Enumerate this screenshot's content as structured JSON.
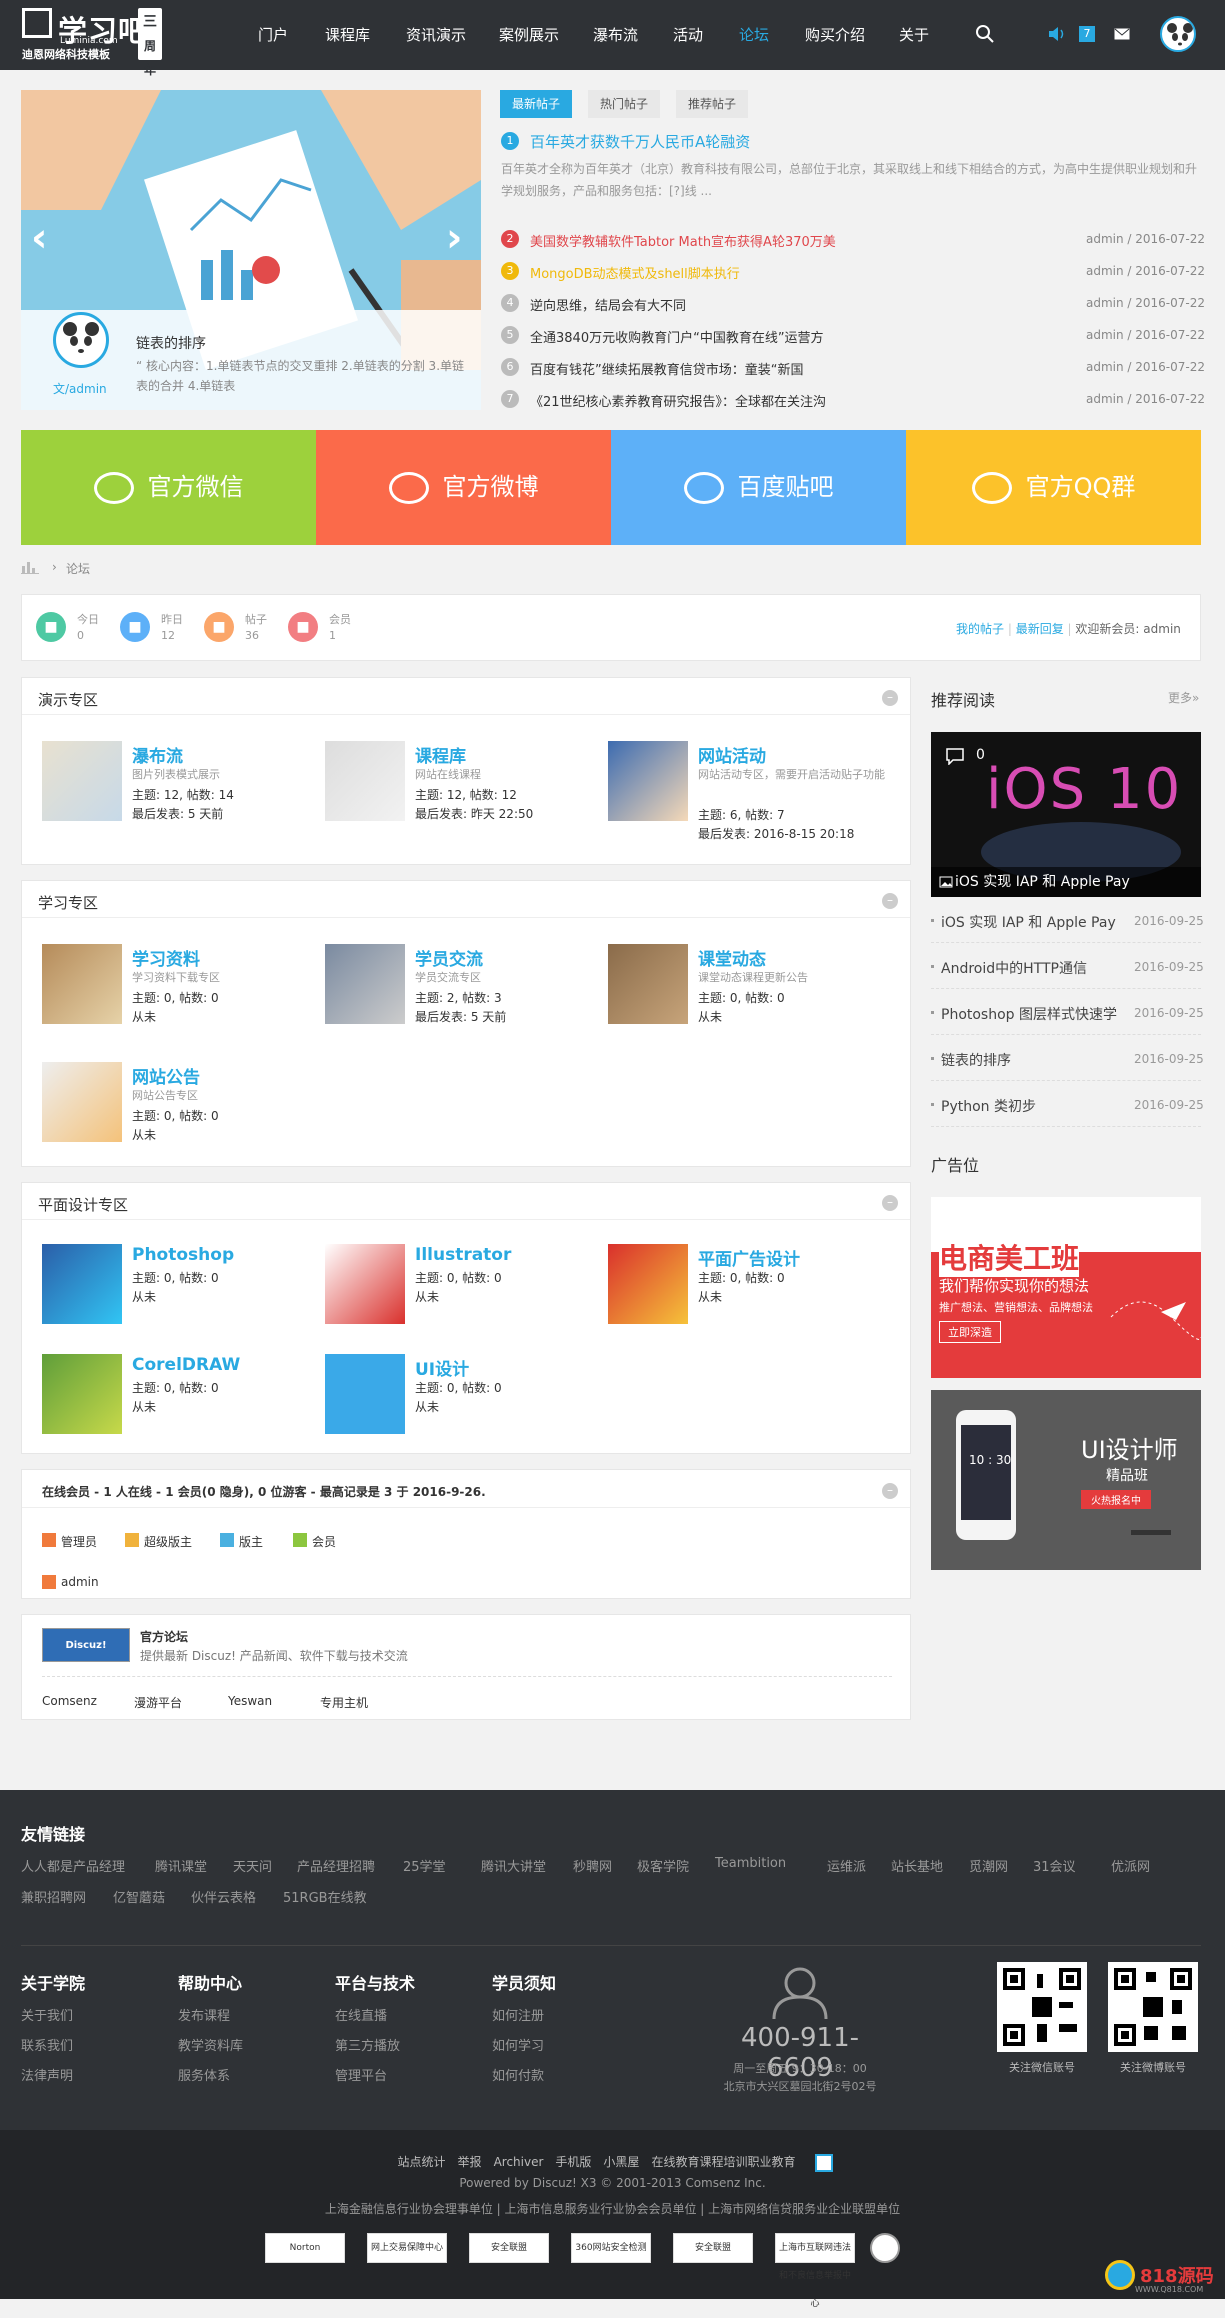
{
  "header": {
    "logo_text": "学习吧",
    "logo_domain": "Luminia.com",
    "logo_sub": "迪恩网络科技模板",
    "badge": "周年",
    "badge_num": "三",
    "nav": [
      "门户",
      "课程库",
      "资讯演示",
      "案例展示",
      "瀑布流",
      "活动",
      "论坛",
      "购买介绍",
      "关于"
    ],
    "active": "论坛",
    "notif_count": "7"
  },
  "slider": {
    "title": "链表的排序",
    "desc": "“ 核心内容：1.单链表节点的交叉重排 2.单链表的分割 3.单链表的合并 4.单链表",
    "author": "文/admin"
  },
  "tabs": [
    "最新帖子",
    "热门帖子",
    "推荐帖子"
  ],
  "featured": {
    "num": "1",
    "title": "百年英才获数千万人民币A轮融资",
    "desc": "百年英才全称为百年英才（北京）教育科技有限公司，总部位于北京，其采取线上和线下相结合的方式，为高中生提供职业规划和升学规划服务，产品和服务包括：[?]线 ..."
  },
  "posts": [
    {
      "num": "2",
      "title": "美国数学教辅软件Tabtor Math宣布获得A轮370万美",
      "meta": "admin / 2016-07-22",
      "color": "#e0474c"
    },
    {
      "num": "3",
      "title": "MongoDB动态模式及shell脚本执行",
      "meta": "admin / 2016-07-22",
      "color": "#f0b90b"
    },
    {
      "num": "4",
      "title": "逆向思维，结局会有大不同",
      "meta": "admin / 2016-07-22",
      "color": "#bbbbbb"
    },
    {
      "num": "5",
      "title": "全通3840万元收购教育门户“中国教育在线”运营方",
      "meta": "admin / 2016-07-22",
      "color": "#bbbbbb"
    },
    {
      "num": "6",
      "title": "百度有钱花”继续拓展教育信贷市场：童装“新国",
      "meta": "admin / 2016-07-22",
      "color": "#bbbbbb"
    },
    {
      "num": "7",
      "title": "《21世纪核心素养教育研究报告》：全球都在关注沟",
      "meta": "admin / 2016-07-22",
      "color": "#bbbbbb"
    }
  ],
  "social": [
    {
      "label": "官方微信",
      "color": "#9dd13c"
    },
    {
      "label": "官方微博",
      "color": "#fb6a4a"
    },
    {
      "label": "百度贴吧",
      "color": "#5db0f8"
    },
    {
      "label": "官方QQ群",
      "color": "#fcc22a"
    }
  ],
  "breadcrumb": "论坛",
  "stats": [
    {
      "label": "今日",
      "value": "0",
      "color": "#4ec9a3"
    },
    {
      "label": "昨日",
      "value": "12",
      "color": "#5db0f8"
    },
    {
      "label": "帖子",
      "value": "36",
      "color": "#fba66a"
    },
    {
      "label": "会员",
      "value": "1",
      "color": "#f27e82"
    }
  ],
  "stats_links": {
    "my": "我的帖子",
    "latest": "最新回复",
    "welcome": "欢迎新会员:",
    "user": "admin"
  },
  "sections": [
    {
      "title": "演示专区",
      "forums": [
        {
          "name": "瀑布流",
          "desc": "图片列表模式展示",
          "l1": "主题: 12, 帖数: 14",
          "l2": "最后发表: 5 天前"
        },
        {
          "name": "课程库",
          "desc": "网站在线课程",
          "l1": "主题: 12, 帖数: 12",
          "l2": "最后发表: 昨天 22:50"
        },
        {
          "name": "网站活动",
          "desc": "网站活动专区，需要开启活动贴子功能",
          "l1": "主题: 6, 帖数: 7",
          "l2": "最后发表: 2016-8-15 20:18"
        }
      ]
    },
    {
      "title": "学习专区",
      "forums": [
        {
          "name": "学习资料",
          "desc": "学习资料下载专区",
          "l1": "主题: 0, 帖数: 0",
          "l2": "从未"
        },
        {
          "name": "学员交流",
          "desc": "学员交流专区",
          "l1": "主题: 2, 帖数: 3",
          "l2": "最后发表: 5 天前"
        },
        {
          "name": "课堂动态",
          "desc": "课堂动态课程更新公告",
          "l1": "主题: 0, 帖数: 0",
          "l2": "从未"
        },
        {
          "name": "网站公告",
          "desc": "网站公告专区",
          "l1": "主题: 0, 帖数: 0",
          "l2": "从未"
        }
      ]
    },
    {
      "title": "平面设计专区",
      "forums": [
        {
          "name": "Photoshop",
          "desc": "",
          "l1": "主题: 0, 帖数: 0",
          "l2": "从未"
        },
        {
          "name": "Illustrator",
          "desc": "",
          "l1": "主题: 0, 帖数: 0",
          "l2": "从未"
        },
        {
          "name": "平面广告设计",
          "desc": "",
          "l1": "主题: 0, 帖数: 0",
          "l2": "从未"
        },
        {
          "name": "CorelDRAW",
          "desc": "",
          "l1": "主题: 0, 帖数: 0",
          "l2": "从未"
        },
        {
          "name": "UI设计",
          "desc": "",
          "l1": "主题: 0, 帖数: 0",
          "l2": "从未"
        }
      ]
    }
  ],
  "online": {
    "title": "在线会员 - 1 人在线 - 1 会员(0 隐身), 0 位游客 - 最高记录是 3 于 2016-9-26.",
    "roles": [
      "管理员",
      "超级版主",
      "版主",
      "会员"
    ],
    "user": "admin"
  },
  "friend_forum": {
    "name": "官方论坛",
    "desc": "提供最新 Discuz! 产品新闻、软件下载与技术交流",
    "logo": "Discuz!",
    "links": [
      "Comsenz",
      "漫游平台",
      "Yeswan",
      "专用主机"
    ]
  },
  "sidebar": {
    "read_title": "推荐阅读",
    "more": "更多»",
    "img_caption": "iOS 实现 IAP 和 Apple Pay",
    "img_count": "0",
    "img_text": "iOS 10",
    "items": [
      {
        "title": "iOS 实现 IAP 和 Apple Pay",
        "date": "2016-09-25"
      },
      {
        "title": "Android中的HTTP通信",
        "date": "2016-09-25"
      },
      {
        "title": "Photoshop 图层样式快速学",
        "date": "2016-09-25"
      },
      {
        "title": "链表的排序",
        "date": "2016-09-25"
      },
      {
        "title": "Python 类初步",
        "date": "2016-09-25"
      }
    ],
    "ad_title": "广告位",
    "ad1": {
      "title": "电商美工班",
      "sub": "我们帮你实现你的想法",
      "sub2": "推广想法、营销想法、品牌想法",
      "btn": "立即深造"
    },
    "ad2": {
      "title": "UI设计师",
      "sub": "精品班",
      "btn": "火热报名中",
      "screen": "10 : 30"
    }
  },
  "footer": {
    "links_title": "友情链接",
    "links": [
      "人人都是产品经理",
      "腾讯课堂",
      "天天问",
      "产品经理招聘",
      "25学堂",
      "腾讯大讲堂",
      "秒聘网",
      "极客学院",
      "Teambition",
      "运维派",
      "站长基地",
      "觅潮网",
      "31会议",
      "优派网",
      "兼职招聘网",
      "亿智蘑菇",
      "伙伴云表格",
      "51RGB在线教"
    ],
    "cols": [
      {
        "title": "关于学院",
        "items": [
          "关于我们",
          "联系我们",
          "法律声明"
        ]
      },
      {
        "title": "帮助中心",
        "items": [
          "发布课程",
          "教学资料库",
          "服务体系"
        ]
      },
      {
        "title": "平台与技术",
        "items": [
          "在线直播",
          "第三方播放",
          "管理平台"
        ]
      },
      {
        "title": "学员须知",
        "items": [
          "如何注册",
          "如何学习",
          "如何付款"
        ]
      }
    ],
    "phone": "400-911-6609",
    "hours": "周一至周五 9：30-18：00",
    "address": "北京市大兴区墓园北街2号02号",
    "qr1": "关注微信账号",
    "qr2": "关注微博账号",
    "bottom_links": [
      "站点统计",
      "举报",
      "Archiver",
      "手机版",
      "小黑屋",
      "在线教育课程培训职业教育"
    ],
    "powered": "Powered by Discuz!   X3 © 2001-2013 Comsenz Inc.",
    "orgs": "上海金融信息行业协会理事单位 | 上海市信息服务业行业协会会员单位 | 上海市网络信贷服务业企业联盟单位",
    "certs": [
      "Norton",
      "网上交易保障中心",
      "安全联盟",
      "360网站安全检测",
      "安全联盟",
      "上海市互联网违法和不良信息举报中心"
    ],
    "watermark": "818源码",
    "watermark_url": "WWW.Q818.COM"
  }
}
